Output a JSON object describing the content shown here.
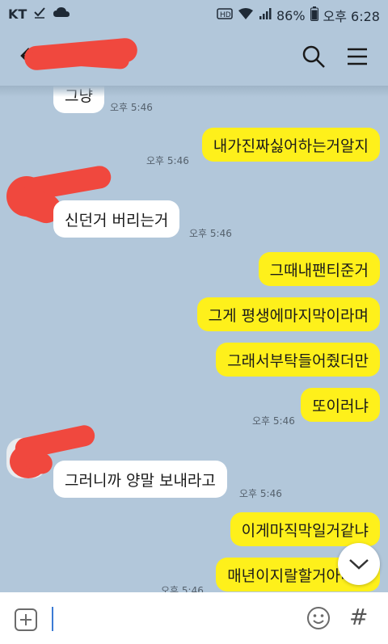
{
  "status_bar": {
    "carrier": "KT",
    "battery": "86%",
    "time": "오후 6:28",
    "icons": [
      "check-icon",
      "cloud-icon",
      "hd-icon",
      "wifi-icon",
      "signal-icon",
      "battery-icon"
    ]
  },
  "header": {
    "title": "",
    "icons": [
      "back-arrow-icon",
      "search-icon",
      "menu-icon"
    ]
  },
  "messages": [
    {
      "side": "in",
      "text": "그냥",
      "time": "오후 5:46"
    },
    {
      "side": "out",
      "text": "내가진짜싫어하는거알지",
      "time": "오후 5:46"
    },
    {
      "side": "in",
      "text": "신던거 버리는거",
      "time": "오후 5:46"
    },
    {
      "side": "out",
      "text": "그때내팬티준거",
      "time": ""
    },
    {
      "side": "out",
      "text": "그게 평생에마지막이라며",
      "time": ""
    },
    {
      "side": "out",
      "text": "그래서부탁들어줬더만",
      "time": ""
    },
    {
      "side": "out",
      "text": "또이러냐",
      "time": "오후 5:46"
    },
    {
      "side": "in",
      "text": "그러니까 양말 보내라고",
      "time": "오후 5:46"
    },
    {
      "side": "out",
      "text": "이게마직막일거같냐",
      "time": ""
    },
    {
      "side": "out",
      "text": "매년이지랄할거아니냐",
      "time": "오후 5:46"
    }
  ],
  "composer": {
    "placeholder": "",
    "icons": [
      "plus-icon",
      "emoji-icon",
      "hash-icon"
    ],
    "hash_label": "#"
  },
  "colors": {
    "background": "#b2c7da",
    "outgoing_bubble": "#fef01b",
    "incoming_bubble": "#ffffff",
    "redaction": "#f0483e"
  }
}
